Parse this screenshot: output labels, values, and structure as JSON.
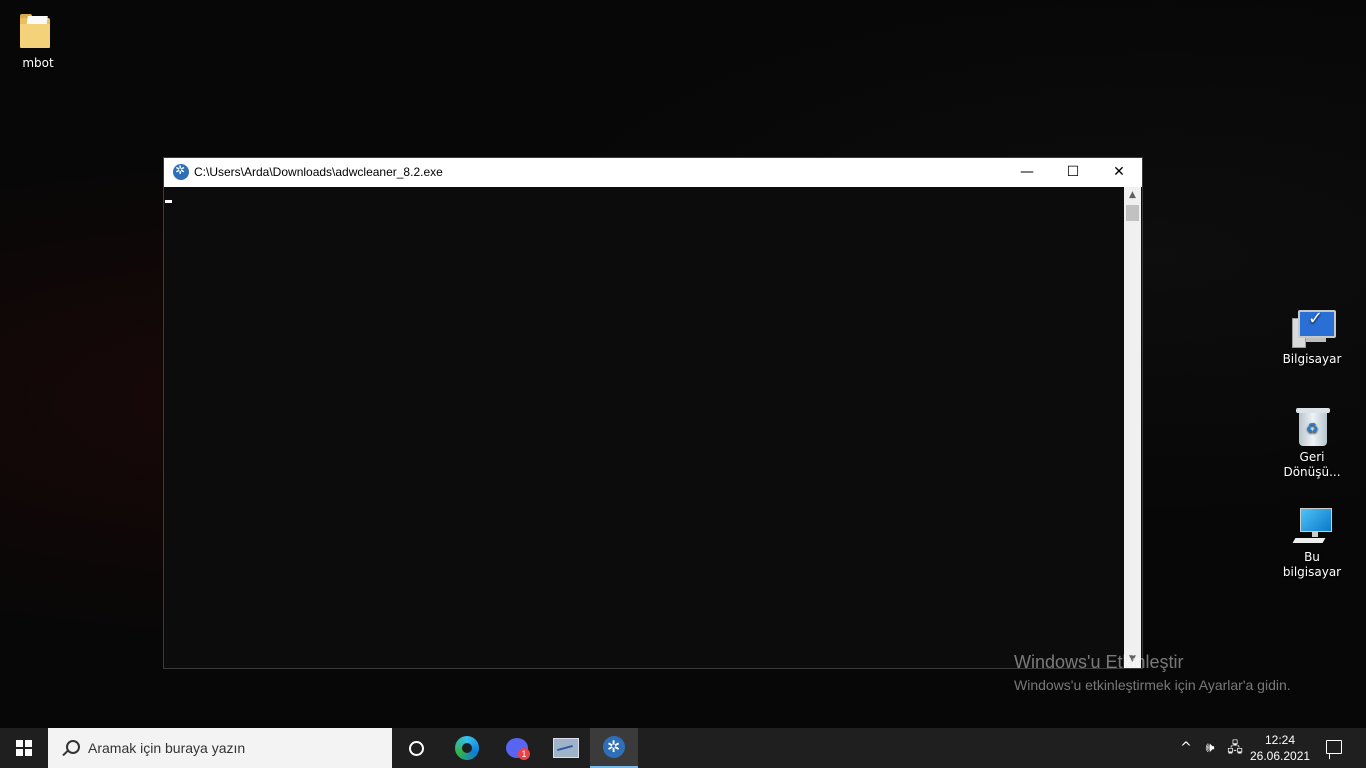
{
  "desktop": {
    "icons": [
      {
        "label": "mbot",
        "icon": "folder-icon"
      },
      {
        "label": "Bilgisayar",
        "icon": "computer-icon"
      },
      {
        "label": "Geri Dönüşü...",
        "icon": "recycle-bin-icon"
      },
      {
        "label": "Bu bilgisayar",
        "icon": "this-pc-icon"
      }
    ]
  },
  "window": {
    "title": "C:\\Users\\Arda\\Downloads\\adwcleaner_8.2.exe",
    "minimize_glyph": "—",
    "maximize_glyph": "☐",
    "close_glyph": "✕"
  },
  "watermark": {
    "title": "Windows'u Etkinleştir",
    "subtitle": "Windows'u etkinleştirmek için Ayarlar'a gidin."
  },
  "taskbar": {
    "search_placeholder": "Aramak için buraya yazın",
    "apps": [
      "cortana",
      "edge",
      "discord",
      "resource-monitor",
      "adwcleaner"
    ],
    "discord_badge": "1",
    "tray": {
      "chevron": "^",
      "volume_glyph": "🕪",
      "network_glyph": "🖧"
    },
    "clock": {
      "time": "12:24",
      "date": "26.06.2021"
    }
  },
  "colors": {
    "taskbar": "#1f1f1f",
    "console": "#0c0c0c",
    "accent": "#76b9ed"
  }
}
